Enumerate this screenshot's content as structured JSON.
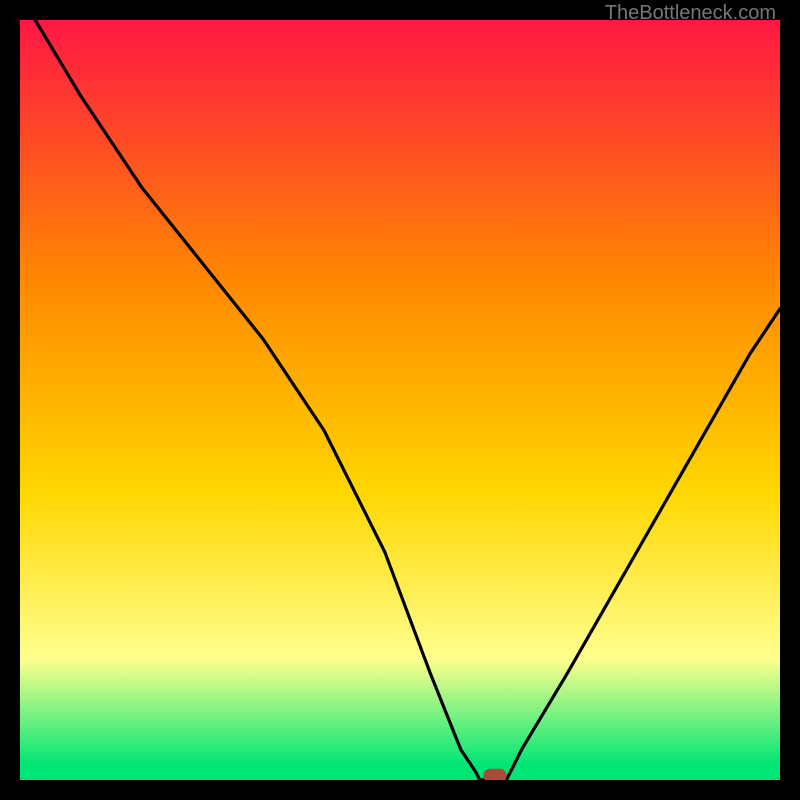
{
  "watermark": "TheBottleneck.com",
  "colors": {
    "bg_outer": "#000000",
    "grad_top": "#ff1744",
    "grad_mid1": "#ff8a00",
    "grad_mid2": "#ffd600",
    "grad_mid3": "#ffff8d",
    "grad_bottom": "#00e676",
    "line": "#000000",
    "marker_fill": "#aa4a3a",
    "marker_stroke": "#aa4a3a"
  },
  "chart_data": {
    "type": "line",
    "title": "",
    "xlabel": "",
    "ylabel": "",
    "xlim": [
      0,
      100
    ],
    "ylim": [
      0,
      100
    ],
    "legend": false,
    "annotations": [],
    "series": [
      {
        "name": "bottleneck-curve",
        "x": [
          2,
          8,
          16,
          24,
          32,
          40,
          48,
          54,
          58,
          60,
          60.5,
          61,
          61.2,
          64,
          66,
          72,
          80,
          88,
          96,
          100
        ],
        "y": [
          100,
          90,
          78,
          68,
          58,
          46,
          30,
          14,
          4,
          1,
          0,
          0,
          0,
          0,
          4,
          14,
          28,
          42,
          56,
          62
        ]
      }
    ],
    "marker": {
      "x": 62.5,
      "y": 0.5
    }
  }
}
